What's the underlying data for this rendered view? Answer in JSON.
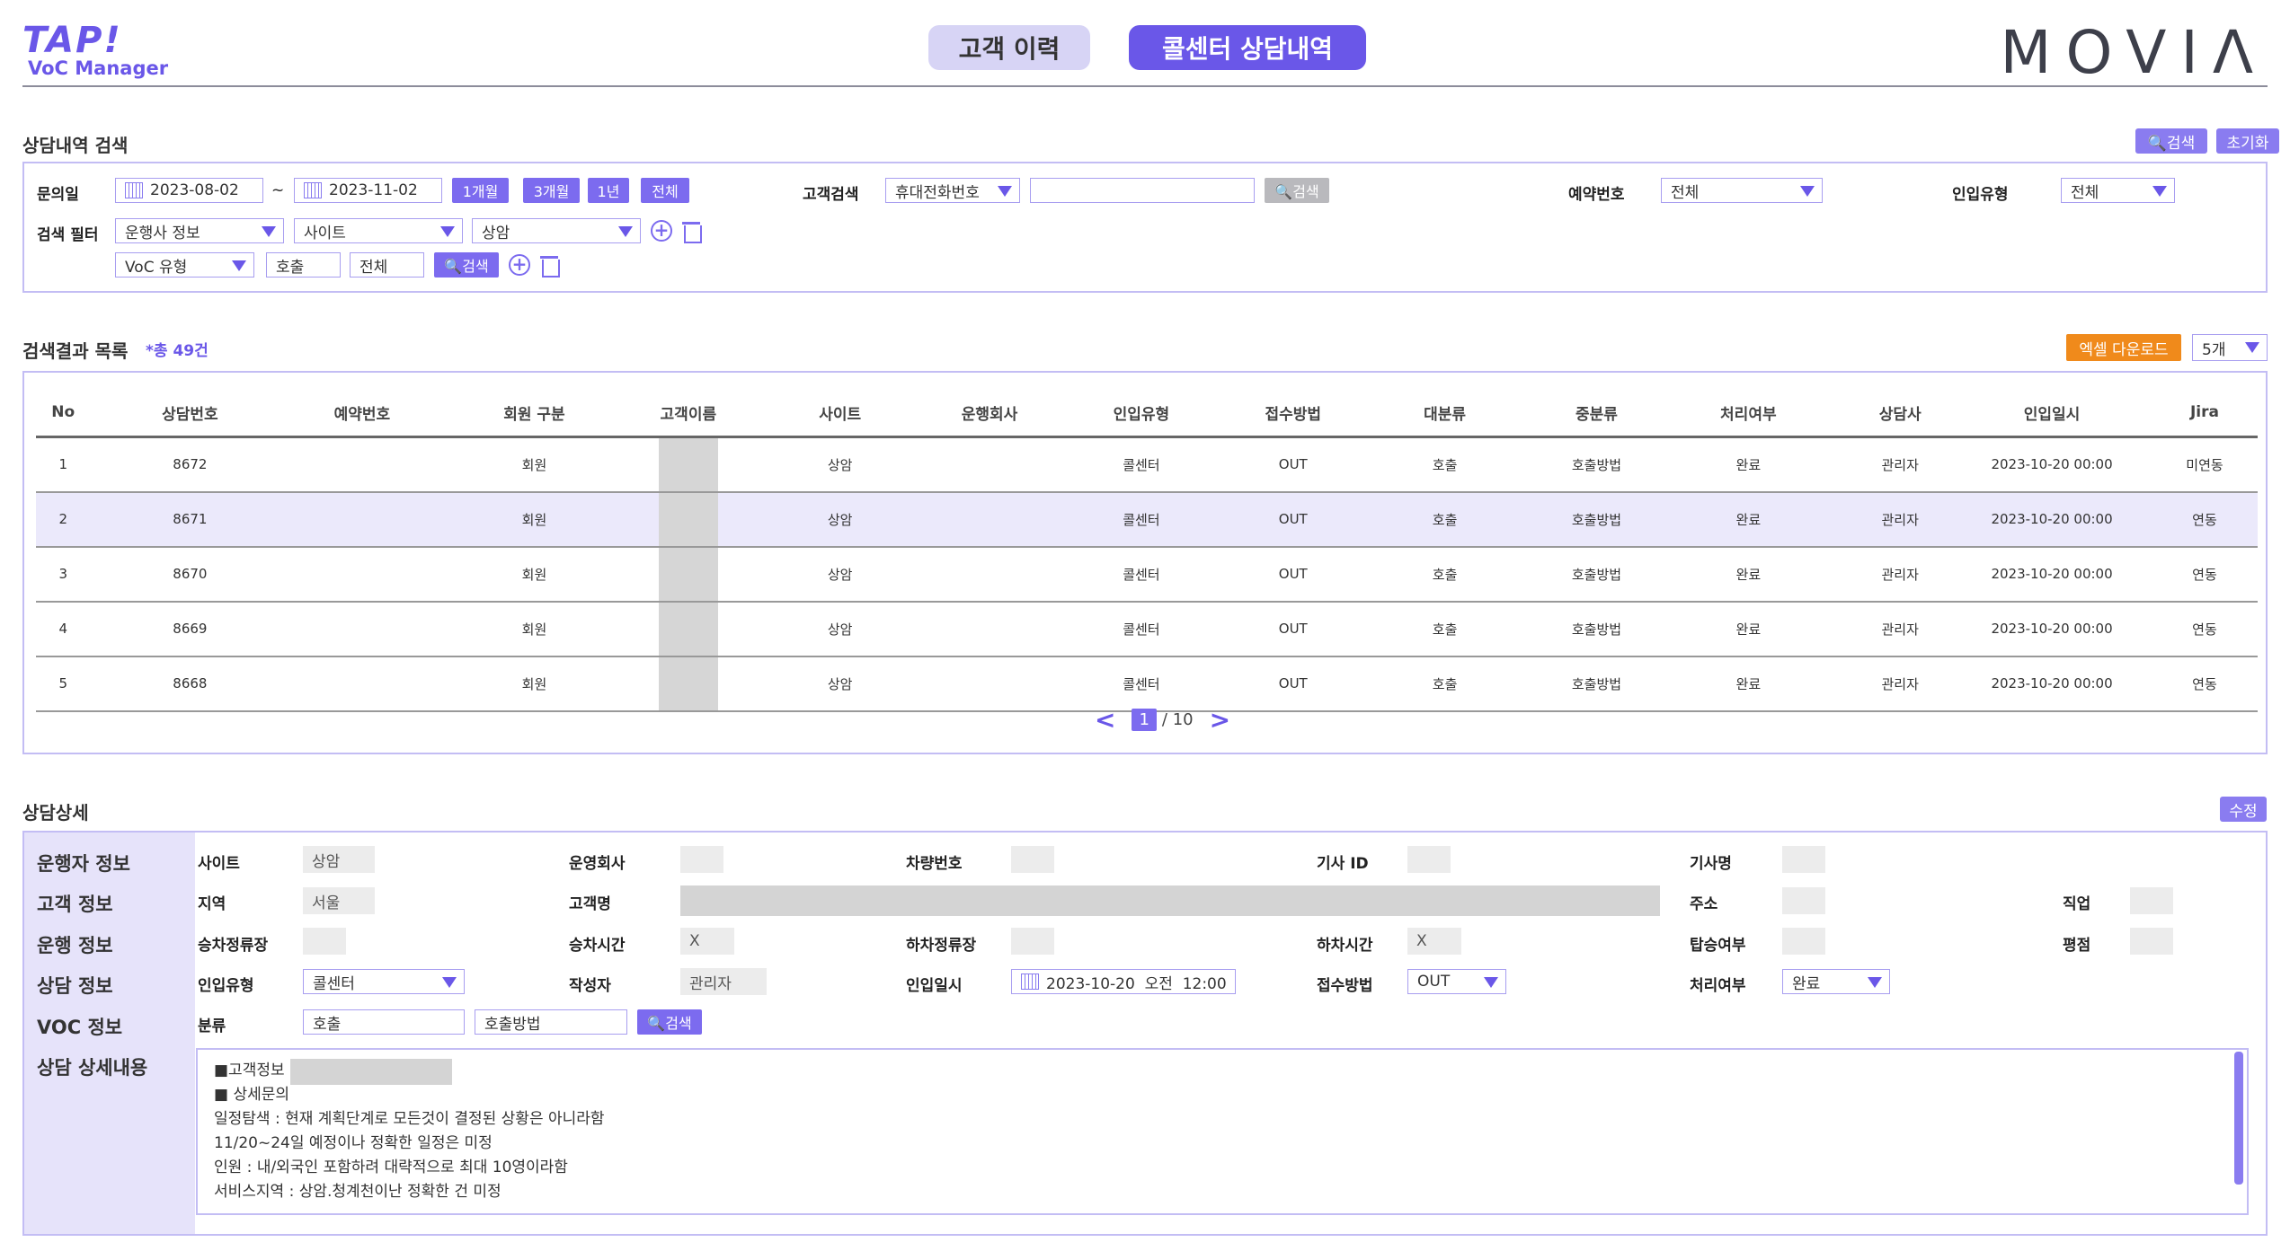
{
  "header": {
    "logo_main": "TAP!",
    "logo_sub": "VoC Manager",
    "tab_history": "고객 이력",
    "tab_callcenter": "콜센터 상담내역",
    "brand": "MOVIΛ"
  },
  "search": {
    "title": "상담내역 검색",
    "search_btn": "🔍검색",
    "reset_btn": "초기화",
    "date_label": "문의일",
    "date_from": "2023-08-02",
    "date_sep": "~",
    "date_to": "2023-11-02",
    "range_1m": "1개월",
    "range_3m": "3개월",
    "range_1y": "1년",
    "range_all": "전체",
    "customer_label": "고객검색",
    "customer_type": "휴대전화번호",
    "customer_value": "",
    "customer_btn": "🔍검색",
    "reservation_label": "예약번호",
    "reservation_value": "전체",
    "inflow_label": "인입유형",
    "inflow_value": "전체",
    "filter_label": "검색 필터",
    "filter1_a": "운행사 정보",
    "filter1_b": "사이트",
    "filter1_c": "상암",
    "filter2_a": "VoC 유형",
    "filter2_b": "호출",
    "filter2_c": "전체",
    "filter2_btn": "🔍검색"
  },
  "results": {
    "title": "검색결과 목록",
    "count": "*총 49건",
    "excel_btn": "엑셀 다운로드",
    "page_size": "5개",
    "columns": [
      "No",
      "상담번호",
      "예약번호",
      "회원 구분",
      "고객이름",
      "사이트",
      "운행회사",
      "인입유형",
      "접수방법",
      "대분류",
      "중분류",
      "처리여부",
      "상담사",
      "인입일시",
      "Jira"
    ],
    "rows": [
      {
        "no": "1",
        "id": "8672",
        "res": "",
        "member": "회원",
        "site": "상암",
        "company": "",
        "inflow": "콜센터",
        "method": "OUT",
        "cat1": "호출",
        "cat2": "호출방법",
        "status": "완료",
        "agent": "관리자",
        "time": "2023-10-20 00:00",
        "jira": "미연동"
      },
      {
        "no": "2",
        "id": "8671",
        "res": "",
        "member": "회원",
        "site": "상암",
        "company": "",
        "inflow": "콜센터",
        "method": "OUT",
        "cat1": "호출",
        "cat2": "호출방법",
        "status": "완료",
        "agent": "관리자",
        "time": "2023-10-20 00:00",
        "jira": "연동"
      },
      {
        "no": "3",
        "id": "8670",
        "res": "",
        "member": "회원",
        "site": "상암",
        "company": "",
        "inflow": "콜센터",
        "method": "OUT",
        "cat1": "호출",
        "cat2": "호출방법",
        "status": "완료",
        "agent": "관리자",
        "time": "2023-10-20 00:00",
        "jira": "연동"
      },
      {
        "no": "4",
        "id": "8669",
        "res": "",
        "member": "회원",
        "site": "상암",
        "company": "",
        "inflow": "콜센터",
        "method": "OUT",
        "cat1": "호출",
        "cat2": "호출방법",
        "status": "완료",
        "agent": "관리자",
        "time": "2023-10-20 00:00",
        "jira": "연동"
      },
      {
        "no": "5",
        "id": "8668",
        "res": "",
        "member": "회원",
        "site": "상암",
        "company": "",
        "inflow": "콜센터",
        "method": "OUT",
        "cat1": "호출",
        "cat2": "호출방법",
        "status": "완료",
        "agent": "관리자",
        "time": "2023-10-20 00:00",
        "jira": "연동"
      }
    ],
    "page_current": "1",
    "page_total": "/ 10"
  },
  "detail": {
    "title": "상담상세",
    "edit_btn": "수정",
    "side": [
      "운행자 정보",
      "고객 정보",
      "운행 정보",
      "상담 정보",
      "VOC 정보",
      "상담 상세내용"
    ],
    "site_label": "사이트",
    "site_value": "상암",
    "company_label": "운영회사",
    "vehicle_label": "차량번호",
    "driver_id_label": "기사 ID",
    "driver_name_label": "기사명",
    "region_label": "지역",
    "region_value": "서울",
    "customer_name_label": "고객명",
    "address_label": "주소",
    "job_label": "직업",
    "board_stop_label": "승차정류장",
    "board_time_label": "승차시간",
    "board_time_value": "X",
    "alight_stop_label": "하차정류장",
    "alight_time_label": "하차시간",
    "alight_time_value": "X",
    "ride_label": "탑승여부",
    "rating_label": "평점",
    "inflow_label": "인입유형",
    "inflow_value": "콜센터",
    "writer_label": "작성자",
    "writer_value": "관리자",
    "inflow_time_label": "인입일시",
    "inflow_time_value": "2023-10-20  오전  12:00",
    "method_label": "접수방법",
    "method_value": "OUT",
    "status_label": "처리여부",
    "status_value": "완료",
    "category_label": "분류",
    "category_1": "호출",
    "category_2": "호출방법",
    "category_btn": "🔍검색",
    "content_lines": [
      "■고객정보",
      " ■ 상세문의",
      "일정탐색 : 현재 계획단계로 모든것이 결정된 상황은 아니라함",
      "11/20~24일 예정이나 정확한 일정은 미정",
      "인원 : 내/외국인 포함하려 대략적으로 최대 10영이라함",
      "서비스지역 : 상암.청계천이난 정확한 건 미정"
    ]
  }
}
